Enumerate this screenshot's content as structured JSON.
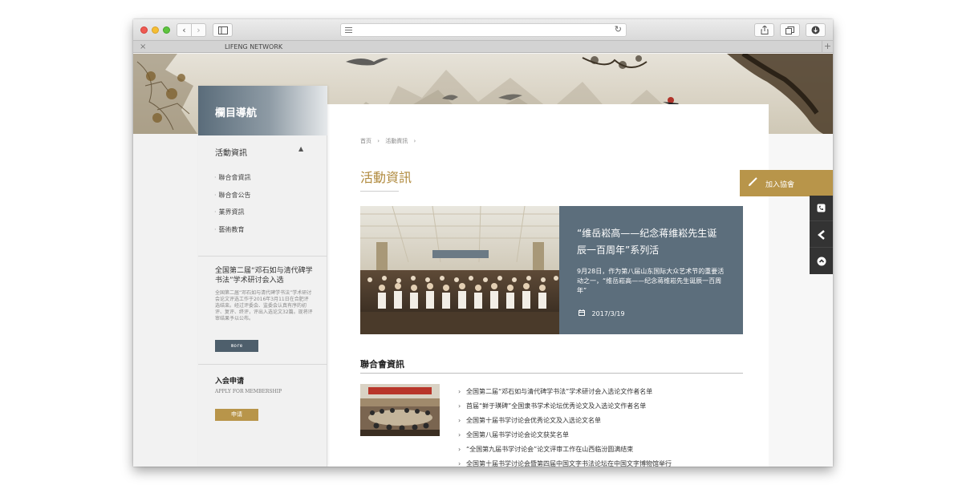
{
  "browser": {
    "tab_title": "LIFENG NETWORK",
    "tab_close": "×",
    "tab_plus": "+",
    "back_label": "‹",
    "forward_label": "›",
    "reload_icon": "↻"
  },
  "sidebar": {
    "heading": "欄目導航",
    "category": "活動資訊",
    "caret": "▲",
    "links": [
      "聯合會資訊",
      "聯合會公告",
      "業界資訊",
      "藝術教育"
    ],
    "news_title": "全国第二届“邓石如与清代碑学书法”学术研讨会入选",
    "news_body": "全国第二届“邓石如与清代碑学书法”学术研讨会论文评选工作于2016年3月11日在合肥评选结束。经过评委会、监委会认真有序的初评、复评、终评，评出入选论文32篇。现将评审结果予以公布。",
    "more_label": "more",
    "apply_title": "入会申请",
    "apply_subtitle": "APPLY FOR MEMBERSHIP",
    "apply_button": "申请"
  },
  "breadcrumb": {
    "home": "首页",
    "sep": "›",
    "current": "活動資訊"
  },
  "page_title": "活動資訊",
  "join": {
    "label": "加入協會"
  },
  "feature": {
    "title": "“维岳崧高——纪念蒋维崧先生诞辰一百周年”系列活",
    "desc": "9月28日，作为第八届山东国际大众艺术节的重要活动之一，“维岳崧高——纪念蒋维崧先生诞辰一百周年”",
    "date": "2017/3/19"
  },
  "section": {
    "title": "聯合會資訊",
    "items": [
      "全国第二届“邓石如与清代碑学书法”学术研讨会入选论文作者名单",
      "首届“鲜于璜碑”全国隶书学术论坛优秀论文及入选论文作者名单",
      "全国第十届书学讨论会优秀论文及入选论文名单",
      "全国第八届书学讨论会论文获奖名单",
      "“全国第九届书学讨论会”论文评审工作在山西临汾圆满结束",
      "全国第十届书学讨论会暨第四届中国文字书法论坛在中国文字博物馆举行"
    ]
  },
  "colors": {
    "gold": "#b8954a",
    "slate": "#5c6e7c",
    "title_gold": "#b08a3e"
  },
  "icons": {
    "brush": "brush-icon",
    "phone": "phone-icon",
    "back": "chevron-left-icon",
    "top": "arrow-up-circle-icon",
    "calendar": "calendar-icon"
  }
}
